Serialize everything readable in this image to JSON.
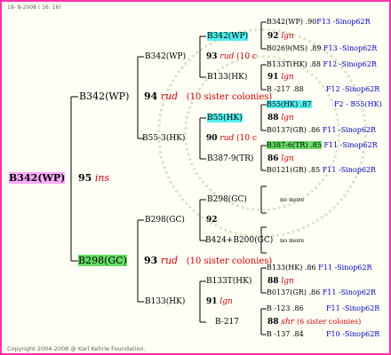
{
  "header": {
    "text": "18- 8-2008 ( 16: 16)"
  },
  "footer": {
    "text": "Copyright 2004-2008 @ Karl Kehrle Foundation."
  },
  "colors": {
    "border": "#ff33aa",
    "highlight_pink": "#ffaaff",
    "highlight_green": "#66dd66",
    "highlight_cyan": "#55eeee",
    "line": "#000000",
    "accent_red": "#cc0000",
    "accent_blue": "#0000bb"
  },
  "root": {
    "id": "B342(WP)",
    "year": "95",
    "tag": "ins"
  },
  "gen1": {
    "sire": {
      "id": "B342(WP)",
      "year": "94",
      "tag": "rud",
      "sisters": "(10 sister colonies)"
    },
    "dam": {
      "id": "B298(GC)",
      "year": "93",
      "tag": "rud",
      "sisters": "(10 sister colonies)"
    }
  },
  "gen2": {
    "a": {
      "id": "B342(WP)",
      "year": "93",
      "tag": "rud",
      "sisters": "(10 c"
    },
    "b": {
      "id": "B55-3(HK)",
      "year": "90",
      "tag": "rud",
      "sisters": "(10 c"
    },
    "c": {
      "id": "B298(GC)",
      "year": "92"
    },
    "d": {
      "id": "B133(HK)",
      "year": "91",
      "tag": "lgn"
    }
  },
  "gen3": {
    "a1": {
      "id": "B342(WP)",
      "year": "92",
      "tag": "lgn"
    },
    "a2": {
      "id": "B133(HK)",
      "year": "91",
      "tag": "lgn"
    },
    "b1": {
      "id": "B55(HK)",
      "year": "88",
      "tag": "lgn"
    },
    "b2": {
      "id": "B387-9(TR)",
      "year": "86",
      "tag": "lgn"
    },
    "c1": {
      "id": "B298(GC)"
    },
    "c2": {
      "id": "B424+B200(GC)"
    },
    "d1": {
      "id": "B133T(HK)",
      "year": "88",
      "tag": "lgn"
    },
    "d2": {
      "id": "B-217",
      "year": "88",
      "tag": "shr",
      "sisters": "(6 sister colonies)"
    }
  },
  "gen4": {
    "a1s": {
      "id": "B342(WP)",
      "val": ".90",
      "ref": "F13 -Sinop62R"
    },
    "a1d": {
      "id": "B0269(MS)",
      "val": ".89",
      "ref": "F13 -Sinop62R"
    },
    "a2s": {
      "id": "B133T(HK)",
      "val": ".88",
      "ref": "F12 -Sinop62R"
    },
    "a2d": {
      "id": "B -217",
      "val": ".88",
      "ref": "F12 -Sinop62R"
    },
    "b1s": {
      "id": "B55(HK)",
      "val": ".87",
      "ref": "F2 - B55(HK)"
    },
    "b1d": {
      "id": "B0137(GR)",
      "val": ".86",
      "ref": "F11 -Sinop62R"
    },
    "b2s": {
      "id": "B387-6(TR)",
      "val": ".85",
      "ref": "F11 -Sinop62R"
    },
    "b2d": {
      "id": "B0121(GR)",
      "val": ".85",
      "ref": "F11 -Sinop62R"
    },
    "c1x": {
      "text": "no more"
    },
    "c2x": {
      "text": "no more"
    },
    "d1s": {
      "id": "B133(HK)",
      "val": ".86",
      "ref": "F11 -Sinop62R"
    },
    "d1d": {
      "id": "B0137(GR)",
      "val": ".86",
      "ref": "F11 -Sinop62R"
    },
    "d2s": {
      "id": "B -123",
      "val": ".86",
      "ref": "F11 -Sinop62R"
    },
    "d2d": {
      "id": "B -137",
      "val": ".84",
      "ref": "F10 -Sinop62R"
    }
  }
}
